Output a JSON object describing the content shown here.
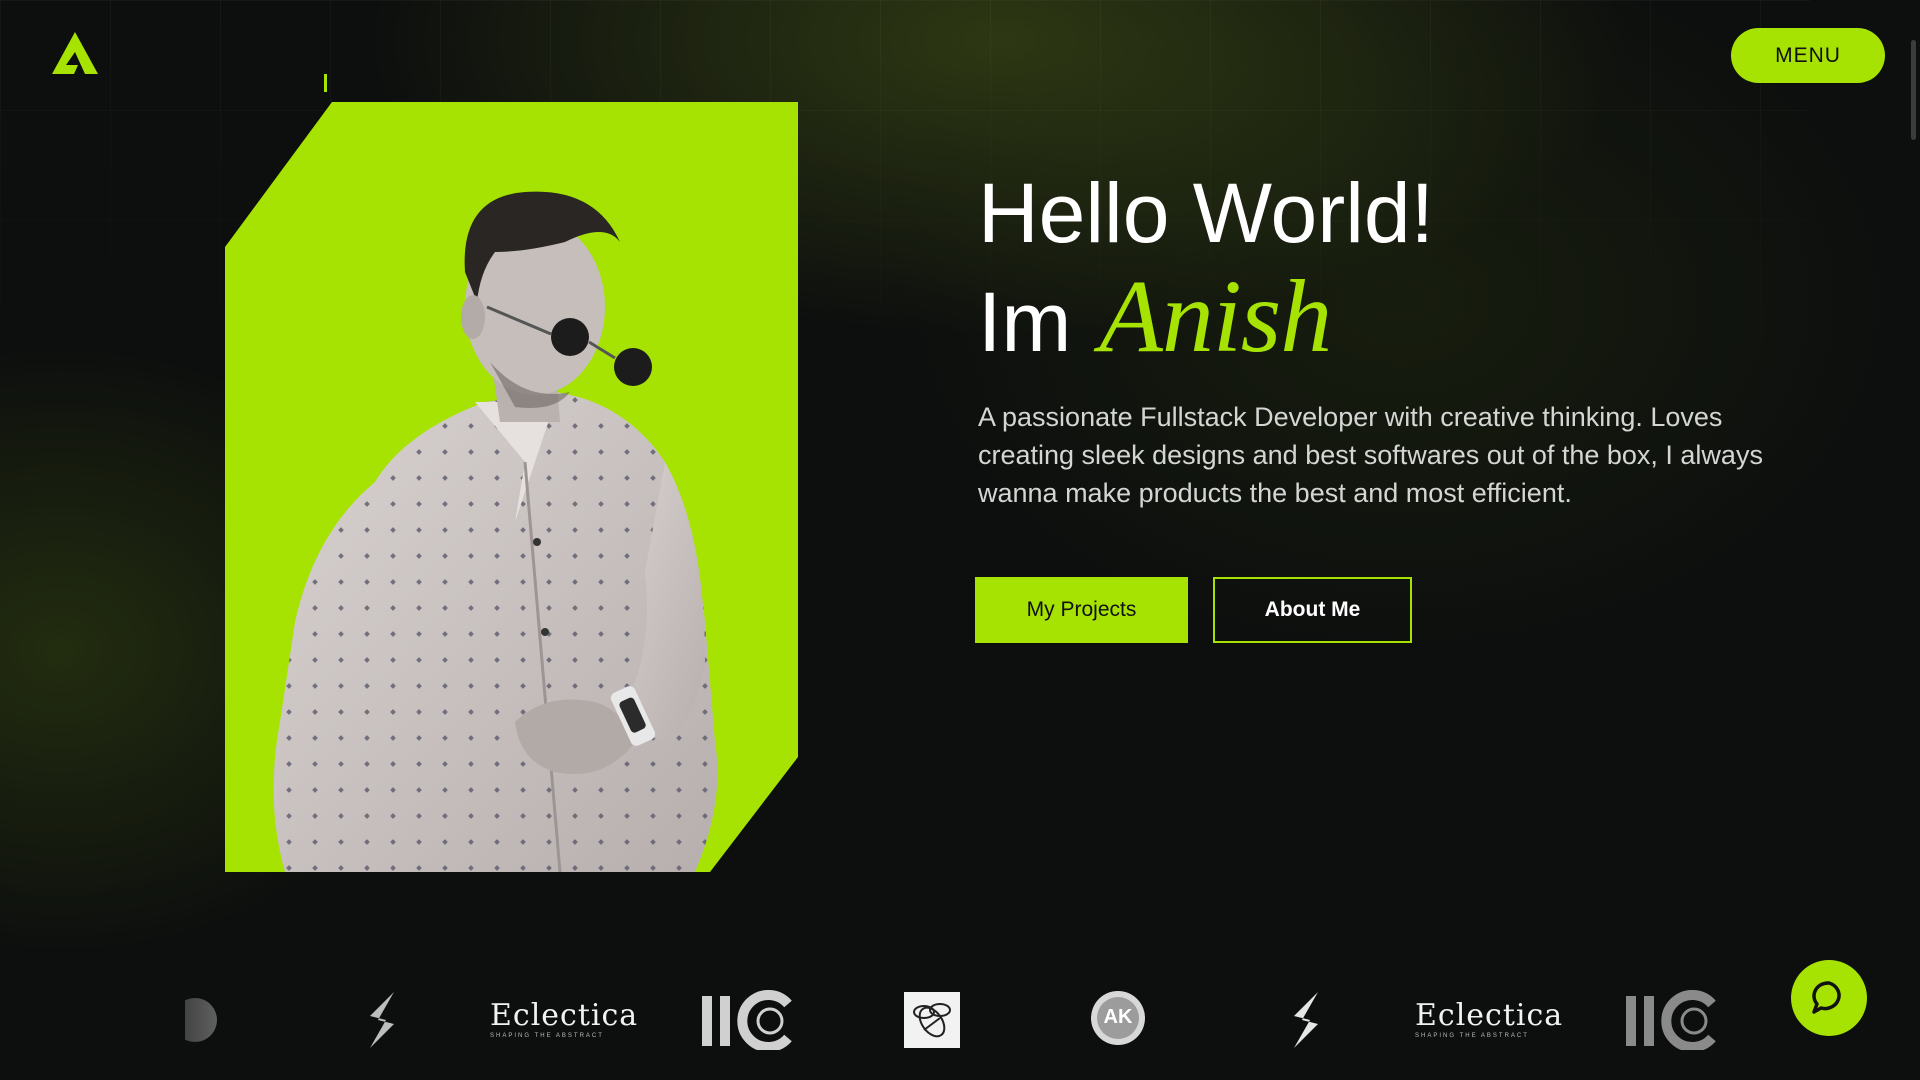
{
  "header": {
    "menu_label": "MENU"
  },
  "hero": {
    "line1": "Hello World!",
    "line2_prefix": "Im",
    "name": "Anish",
    "description": "A passionate Fullstack Developer with creative thinking. Loves creating sleek designs and best softwares out of the box, I always wanna make products the best and most efficient.",
    "buttons": {
      "projects": "My Projects",
      "about": "About Me"
    }
  },
  "logo_strip": {
    "eclectica_1": "Eclectica",
    "eclectica_1_sub": "SHAPING THE ABSTRACT",
    "eclectica_2": "Eclectica",
    "eclectica_2_sub": "SHAPING THE ABSTRACT",
    "ak_badge_1": "AK"
  },
  "icons": {
    "logo": "a-logo-icon",
    "chat": "chat-bubble-icon"
  },
  "colors": {
    "accent": "#a6e302",
    "background": "#0d0f0e",
    "text": "#ffffff",
    "muted_text": "#d4d6d4"
  }
}
